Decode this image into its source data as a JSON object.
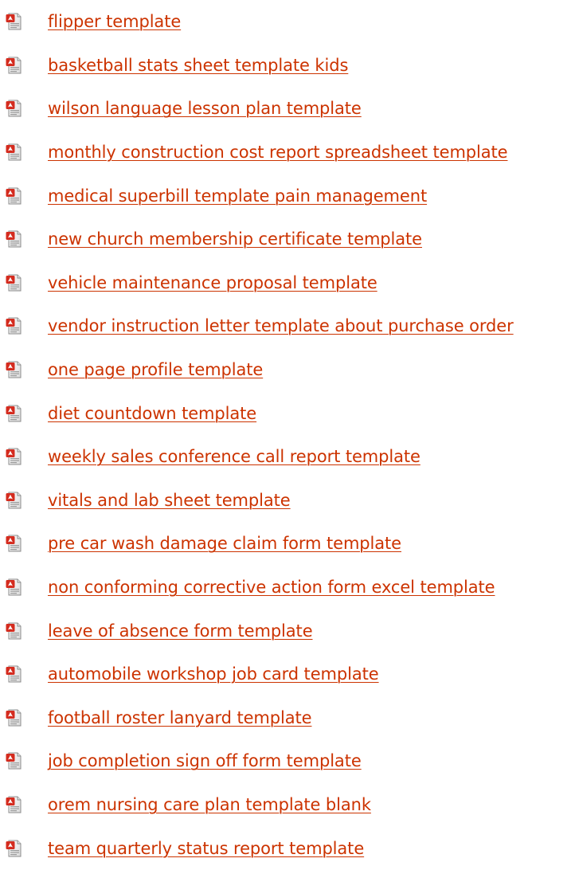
{
  "links": [
    {
      "label": "flipper template",
      "icon": "pdf-document-icon"
    },
    {
      "label": "basketball stats sheet template kids",
      "icon": "pdf-document-icon"
    },
    {
      "label": "wilson language lesson plan template",
      "icon": "pdf-document-icon"
    },
    {
      "label": "monthly construction cost report spreadsheet template",
      "icon": "pdf-document-icon"
    },
    {
      "label": "medical superbill template pain management",
      "icon": "pdf-document-icon"
    },
    {
      "label": "new church membership certificate template",
      "icon": "pdf-document-icon"
    },
    {
      "label": "vehicle maintenance proposal template",
      "icon": "pdf-document-icon"
    },
    {
      "label": "vendor instruction letter template about purchase order",
      "icon": "pdf-document-icon"
    },
    {
      "label": "one page profile template",
      "icon": "pdf-document-icon"
    },
    {
      "label": "diet countdown template",
      "icon": "pdf-document-icon"
    },
    {
      "label": "weekly sales conference call report template",
      "icon": "pdf-document-icon"
    },
    {
      "label": "vitals and lab sheet template",
      "icon": "pdf-document-icon"
    },
    {
      "label": "pre car wash damage claim form template",
      "icon": "pdf-document-icon"
    },
    {
      "label": "non conforming corrective action form excel template",
      "icon": "pdf-document-icon"
    },
    {
      "label": "leave of absence form template",
      "icon": "pdf-document-icon"
    },
    {
      "label": "automobile workshop job card template",
      "icon": "pdf-document-icon"
    },
    {
      "label": "football roster lanyard template",
      "icon": "pdf-document-icon"
    },
    {
      "label": "job completion sign off form template",
      "icon": "pdf-document-icon"
    },
    {
      "label": "orem nursing care plan template blank",
      "icon": "pdf-document-icon"
    },
    {
      "label": "team quarterly status report template",
      "icon": "pdf-document-icon"
    }
  ],
  "colors": {
    "link": "#cc3300",
    "icon_red": "#d42b1e",
    "background": "#ffffff"
  }
}
